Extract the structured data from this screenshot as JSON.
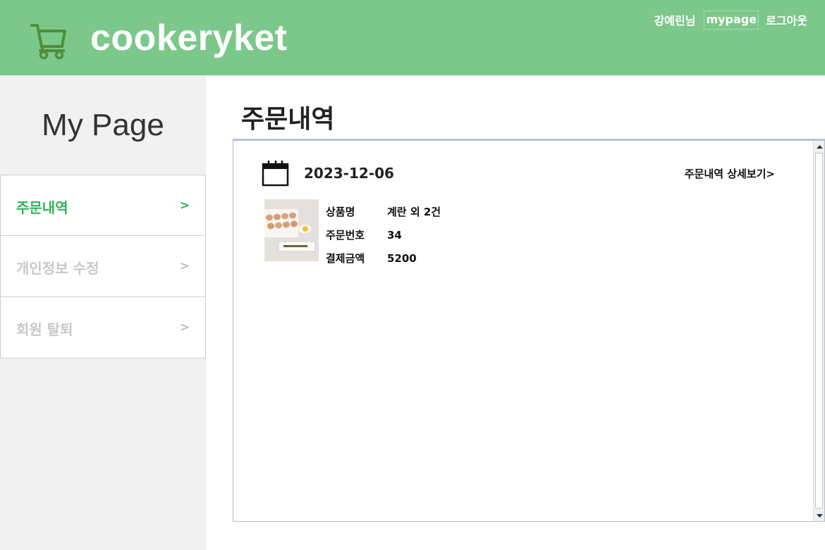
{
  "header": {
    "brand": "cookeryket",
    "user_label": "강예린님",
    "mypage_label": "mypage",
    "logout_label": "로그아웃",
    "bg_color": "#7cc88a",
    "cart_icon": "cart-icon"
  },
  "sidebar": {
    "title": "My Page",
    "items": [
      {
        "label": "주문내역",
        "arrow": ">",
        "active": true
      },
      {
        "label": "개인정보 수정",
        "arrow": ">",
        "active": false
      },
      {
        "label": "회원 탈퇴",
        "arrow": ">",
        "active": false
      }
    ],
    "active_color": "#2fb35a"
  },
  "main": {
    "title": "주문내역",
    "orders": [
      {
        "date": "2023-12-06",
        "detail_link": "주문내역 상세보기>",
        "product_name_label": "상품명",
        "product_name": "계란 외 2건",
        "order_no_label": "주문번호",
        "order_no": "34",
        "amount_label": "결제금액",
        "amount": "5200"
      }
    ]
  }
}
